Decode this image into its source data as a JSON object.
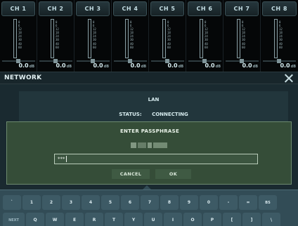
{
  "mixer": {
    "channels": [
      {
        "label": "CH 1",
        "gain": "0.0",
        "unit": "dB"
      },
      {
        "label": "CH 2",
        "gain": "0.0",
        "unit": "dB"
      },
      {
        "label": "CH 3",
        "gain": "0.0",
        "unit": "dB"
      },
      {
        "label": "CH 4",
        "gain": "0.0",
        "unit": "dB"
      },
      {
        "label": "CH 5",
        "gain": "0.0",
        "unit": "dB"
      },
      {
        "label": "CH 6",
        "gain": "0.0",
        "unit": "dB"
      },
      {
        "label": "CH 7",
        "gain": "0.0",
        "unit": "dB"
      },
      {
        "label": "CH 8",
        "gain": "0.0",
        "unit": "dB"
      }
    ],
    "scale": [
      "0",
      "6",
      "12",
      "18",
      "24",
      "30",
      "40",
      "60"
    ]
  },
  "network": {
    "title": "NETWORK",
    "close_icon": "close-icon",
    "lan_label": "LAN",
    "status_label": "STATUS:",
    "status_value": "CONNECTING"
  },
  "dialog": {
    "title": "ENTER PASSPHRASE",
    "password_value": "***",
    "cancel_label": "CANCEL",
    "ok_label": "OK"
  },
  "keyboard": {
    "row1": [
      "`",
      "1",
      "2",
      "3",
      "4",
      "5",
      "6",
      "7",
      "8",
      "9",
      "0",
      "-",
      "=",
      "BS"
    ],
    "row2": [
      "NEXT",
      "Q",
      "W",
      "E",
      "R",
      "T",
      "Y",
      "U",
      "I",
      "O",
      "P",
      "[",
      "]",
      "\\"
    ]
  },
  "colors": {
    "dialog_bg": "#354d38",
    "panel_bg": "#1a2a30",
    "keyboard_bg": "#324c56"
  }
}
